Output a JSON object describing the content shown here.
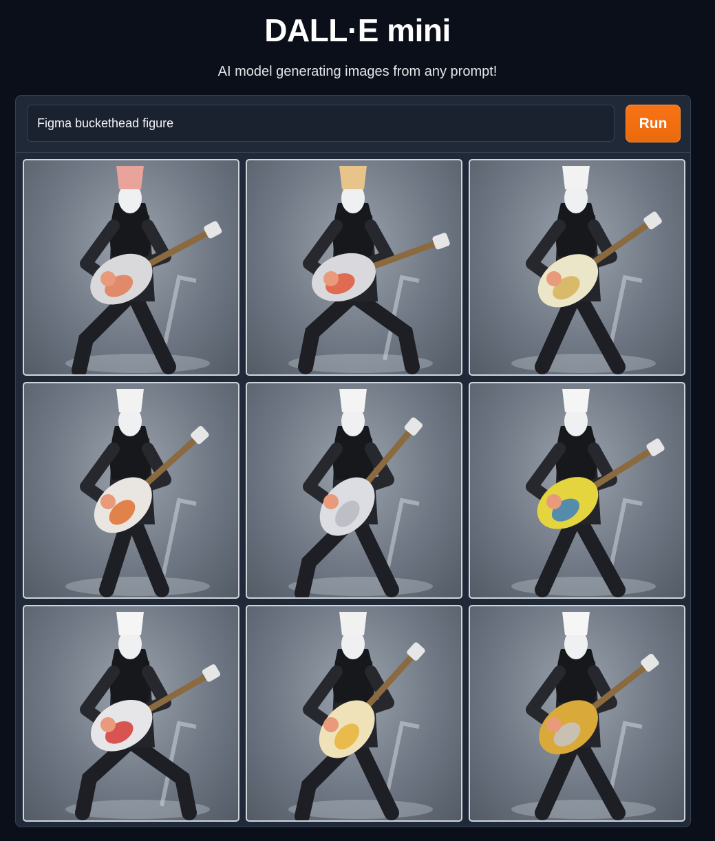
{
  "header": {
    "title": "DALL·E mini",
    "subtitle": "AI model generating images from any prompt!"
  },
  "prompt": {
    "value": "Figma buckethead figure"
  },
  "run_button": {
    "label": "Run"
  },
  "colors": {
    "background": "#0b0f19",
    "panel": "#1f2937",
    "accent": "#f97316"
  },
  "gallery": {
    "images": [
      {
        "bucket": "#e8a39a",
        "guitar": "#d9d9dc",
        "guitar_accent": "#e07b55",
        "tilt": -28,
        "pose": "lunge"
      },
      {
        "bucket": "#e6c48a",
        "guitar": "#d8d8dd",
        "guitar_accent": "#e0583a",
        "tilt": -20,
        "pose": "crouch"
      },
      {
        "bucket": "#f2f2f2",
        "guitar": "#ece6c8",
        "guitar_accent": "#d6b25a",
        "tilt": -35,
        "pose": "wide"
      },
      {
        "bucket": "#f2f2f2",
        "guitar": "#e9e6e1",
        "guitar_accent": "#e07030",
        "tilt": -42,
        "pose": "lean"
      },
      {
        "bucket": "#f4f4f4",
        "guitar": "#dcdde2",
        "guitar_accent": "#b9b9c2",
        "tilt": -50,
        "pose": "lunge"
      },
      {
        "bucket": "#f5f5f5",
        "guitar": "#e4d53e",
        "guitar_accent": "#3c7fc0",
        "tilt": -32,
        "pose": "wide"
      },
      {
        "bucket": "#f5f5f5",
        "guitar": "#e6e6e8",
        "guitar_accent": "#d53a35",
        "tilt": -30,
        "pose": "crouch"
      },
      {
        "bucket": "#f1f1f1",
        "guitar": "#f0e2b8",
        "guitar_accent": "#e8b43a",
        "tilt": -48,
        "pose": "lunge"
      },
      {
        "bucket": "#f6f6f6",
        "guitar": "#d9a93a",
        "guitar_accent": "#c4c4c8",
        "tilt": -38,
        "pose": "wide"
      }
    ]
  }
}
